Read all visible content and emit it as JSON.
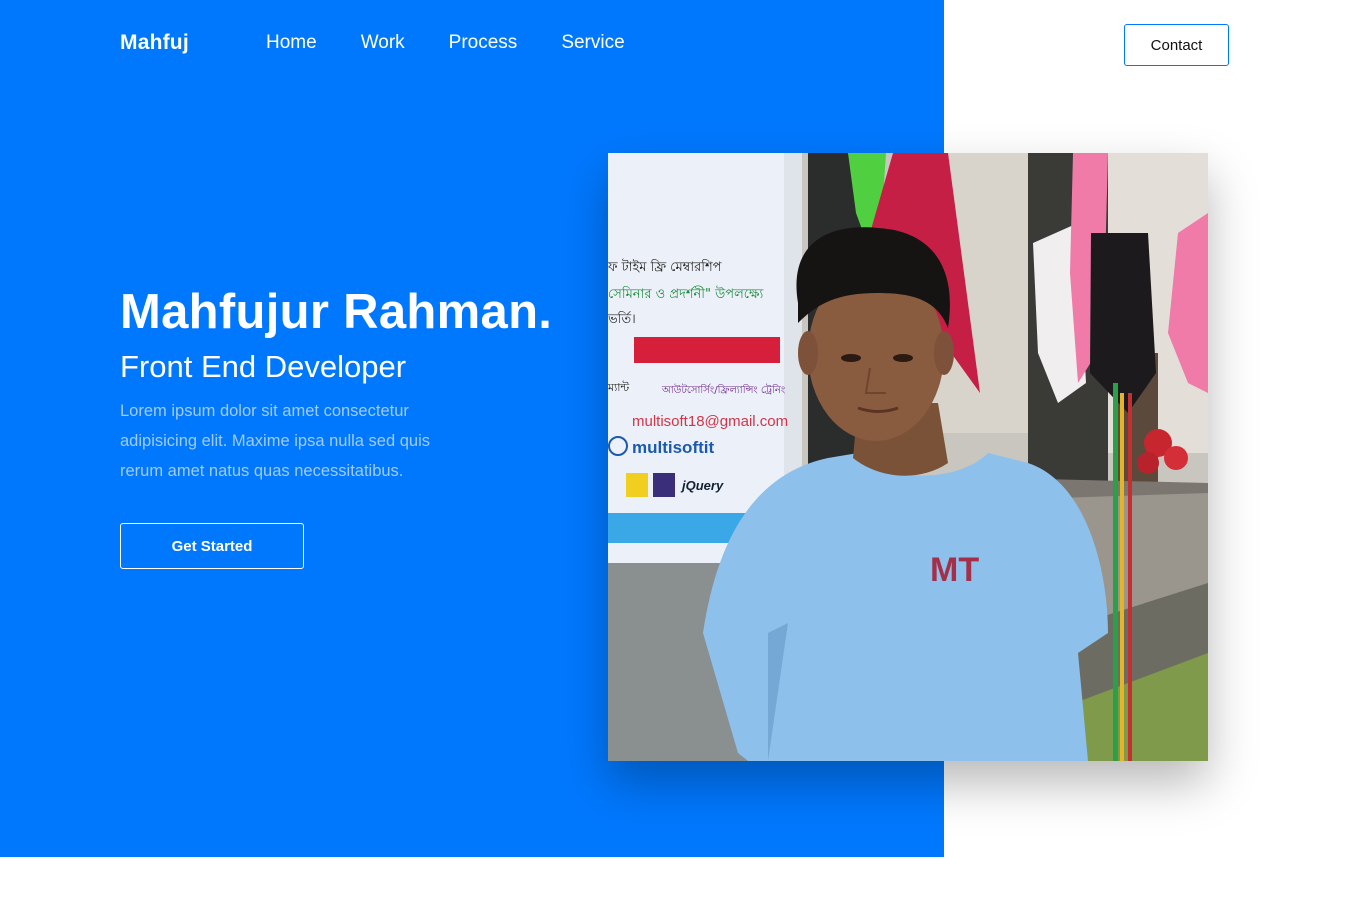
{
  "brand": {
    "logo": "Mahfuj"
  },
  "nav": {
    "items": [
      "Home",
      "Work",
      "Process",
      "Service"
    ]
  },
  "header": {
    "contact_label": "Contact"
  },
  "hero": {
    "name": "Mahfujur Rahman.",
    "role": "Front End Developer",
    "description": "Lorem ipsum dolor sit amet consectetur adipisicing elit. Maxime ipsa nulla sed quis rerum amet natus quas necessitatibus.",
    "cta_label": "Get Started"
  },
  "photo": {
    "banner_lines": [
      "ফ টাইম ফ্রি মেম্বারশিপ",
      "সেমিনার ও প্রদর্শনী\" উপলক্ষ্যে",
      "ভর্তি।",
      "ম্যান্ট",
      "আউটসোর্সিং/ফ্রিল্যান্সিং ট্রেনিং"
    ],
    "email": "multisoft18@gmail.com",
    "facebook": "multisoftit",
    "jquery": "jQuery",
    "shirt_logo": "MT"
  },
  "colors": {
    "primary": "#0078fe",
    "background": "#ffffff",
    "muted_text": "#9fcbff"
  }
}
